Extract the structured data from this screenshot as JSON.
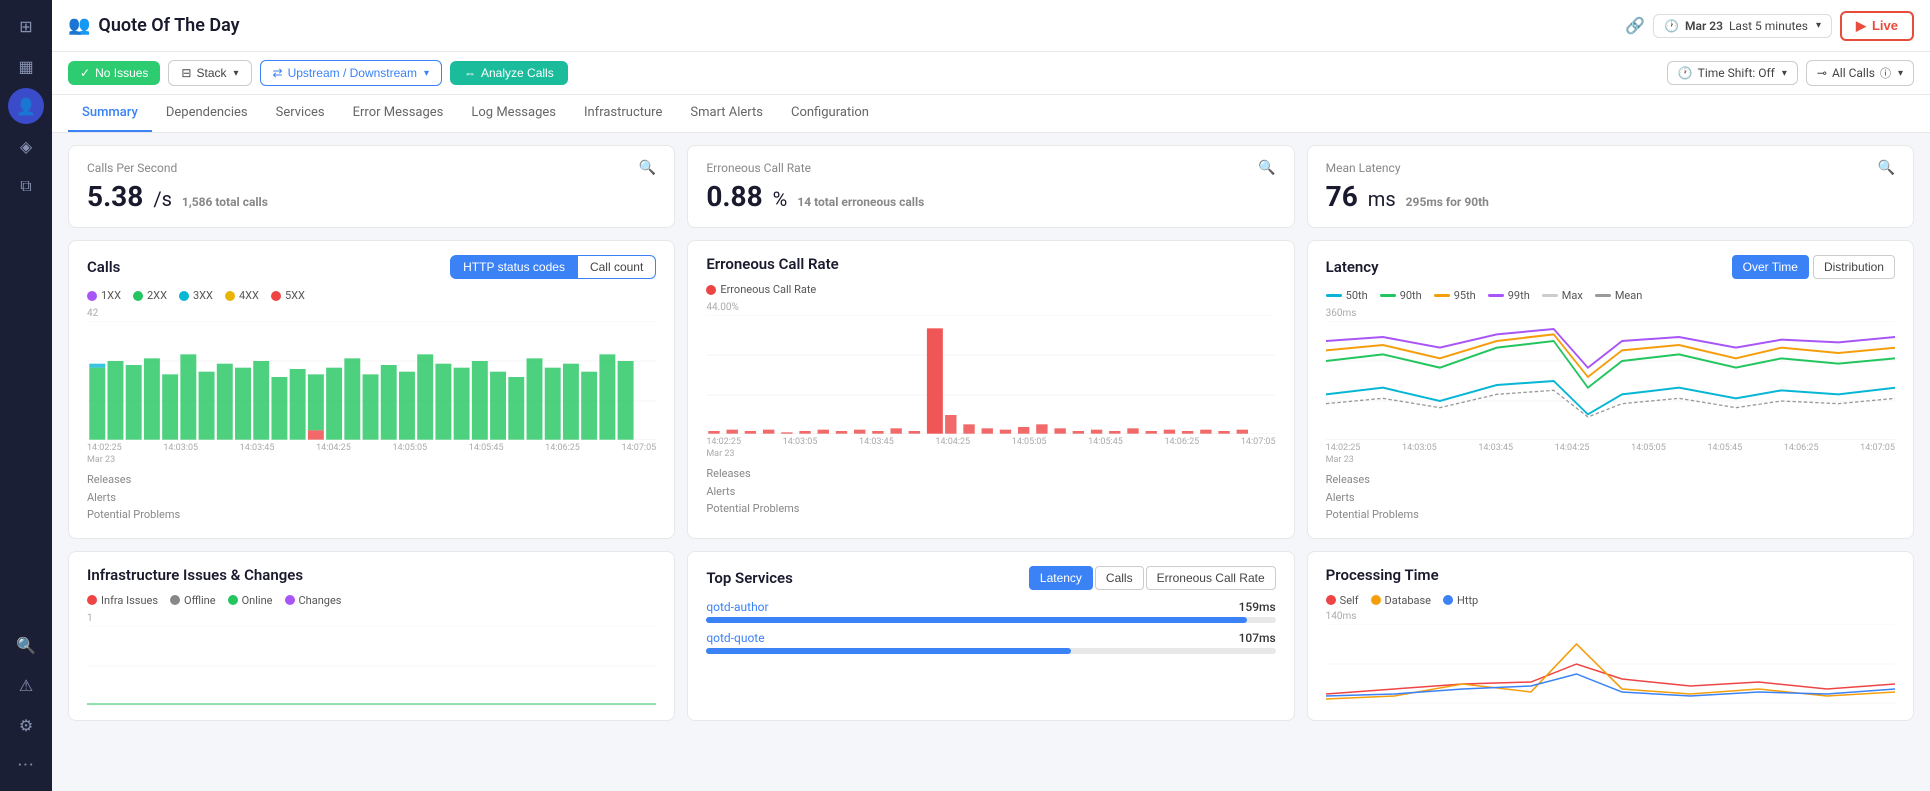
{
  "sidebar": {
    "icons": [
      {
        "name": "home-icon",
        "symbol": "⊞",
        "active": false
      },
      {
        "name": "grid-icon",
        "symbol": "▦",
        "active": false
      },
      {
        "name": "user-icon",
        "symbol": "👤",
        "active": true
      },
      {
        "name": "tag-icon",
        "symbol": "◈",
        "active": false
      },
      {
        "name": "layers-icon",
        "symbol": "⧉",
        "active": false
      },
      {
        "name": "search-icon",
        "symbol": "🔍",
        "active": false
      },
      {
        "name": "alert-icon",
        "symbol": "⚠",
        "active": false
      },
      {
        "name": "settings-icon",
        "symbol": "⚙",
        "active": false
      },
      {
        "name": "more-icon",
        "symbol": "•••",
        "active": false
      }
    ]
  },
  "header": {
    "service_icon": "👥",
    "title": "Quote Of The Day",
    "link_icon": "🔗",
    "date_label": "Mar 23",
    "time_range": "Last 5 minutes",
    "live_label": "Live"
  },
  "filterbar": {
    "no_issues_label": "No Issues",
    "stack_label": "Stack",
    "upstream_downstream_label": "Upstream / Downstream",
    "analyze_calls_label": "Analyze Calls",
    "time_shift_label": "Time Shift: Off",
    "all_calls_label": "All Calls"
  },
  "navtabs": {
    "tabs": [
      {
        "label": "Summary",
        "active": true
      },
      {
        "label": "Dependencies",
        "active": false
      },
      {
        "label": "Services",
        "active": false
      },
      {
        "label": "Error Messages",
        "active": false
      },
      {
        "label": "Log Messages",
        "active": false
      },
      {
        "label": "Infrastructure",
        "active": false
      },
      {
        "label": "Smart Alerts",
        "active": false
      },
      {
        "label": "Configuration",
        "active": false
      }
    ]
  },
  "metrics": {
    "calls_per_second": {
      "label": "Calls Per Second",
      "value": "5.38",
      "unit": "/s",
      "sub": "1,586 total calls"
    },
    "erroneous_call_rate": {
      "label": "Erroneous Call Rate",
      "value": "0.88",
      "unit": "%",
      "sub": "14 total erroneous calls"
    },
    "mean_latency": {
      "label": "Mean Latency",
      "value": "76",
      "unit": "ms",
      "sub": "295ms for 90th"
    }
  },
  "calls_chart": {
    "title": "Calls",
    "btn_active": "HTTP status codes",
    "btn_inactive": "Call count",
    "legend": [
      {
        "label": "1XX",
        "color": "#a855f7"
      },
      {
        "label": "2XX",
        "color": "#22c55e"
      },
      {
        "label": "3XX",
        "color": "#06b6d4"
      },
      {
        "label": "4XX",
        "color": "#eab308"
      },
      {
        "label": "5XX",
        "color": "#ef4444"
      }
    ],
    "y_max": "42",
    "x_labels": [
      "14:02:25",
      "14:03:05",
      "14:03:45",
      "14:04:25",
      "14:05:05",
      "14:05:45",
      "14:06:25",
      "14:07:05"
    ],
    "date_label": "Mar 23",
    "footer": [
      "Releases",
      "Alerts",
      "Potential Problems"
    ]
  },
  "erroneous_chart": {
    "title": "Erroneous Call Rate",
    "legend_label": "Erroneous Call Rate",
    "legend_color": "#ef4444",
    "y_max": "44.00%",
    "x_labels": [
      "14:02:25",
      "14:03:05",
      "14:03:45",
      "14:04:25",
      "14:05:05",
      "14:05:45",
      "14:06:25",
      "14:07:05"
    ],
    "date_label": "Mar 23",
    "footer": [
      "Releases",
      "Alerts",
      "Potential Problems"
    ]
  },
  "latency_chart": {
    "title": "Latency",
    "tab_active": "Over Time",
    "tab_inactive": "Distribution",
    "legend": [
      {
        "label": "50th",
        "color": "#06b6d4"
      },
      {
        "label": "90th",
        "color": "#22c55e"
      },
      {
        "label": "95th",
        "color": "#f59e0b"
      },
      {
        "label": "99th",
        "color": "#a855f7"
      },
      {
        "label": "Max",
        "color": "#ccc"
      },
      {
        "label": "Mean",
        "color": "#ccc"
      }
    ],
    "y_max": "360ms",
    "x_labels": [
      "14:02:25",
      "14:03:05",
      "14:03:45",
      "14:04:25",
      "14:05:05",
      "14:05:45",
      "14:06:25",
      "14:07:05"
    ],
    "date_label": "Mar 23",
    "footer": [
      "Releases",
      "Alerts",
      "Potential Problems"
    ]
  },
  "infra_card": {
    "title": "Infrastructure Issues & Changes",
    "legend": [
      {
        "label": "Infra Issues",
        "color": "#ef4444"
      },
      {
        "label": "Offline",
        "color": "#888"
      },
      {
        "label": "Online",
        "color": "#22c55e"
      },
      {
        "label": "Changes",
        "color": "#a855f7"
      }
    ],
    "y_val": "1"
  },
  "top_services": {
    "title": "Top Services",
    "tab_latency": "Latency",
    "tab_calls": "Calls",
    "tab_erroneous": "Erroneous Call Rate",
    "services": [
      {
        "name": "qotd-author",
        "value": "159ms",
        "pct": 95
      },
      {
        "name": "qotd-quote",
        "value": "107ms",
        "pct": 64
      }
    ]
  },
  "processing_time": {
    "title": "Processing Time",
    "legend": [
      {
        "label": "Self",
        "color": "#ef4444"
      },
      {
        "label": "Database",
        "color": "#f59e0b"
      },
      {
        "label": "Http",
        "color": "#3b82f6"
      }
    ],
    "y_max": "140ms"
  },
  "colors": {
    "accent": "#3b82f6",
    "green": "#2ecc71",
    "teal": "#1abc9c",
    "red": "#ef4444"
  }
}
